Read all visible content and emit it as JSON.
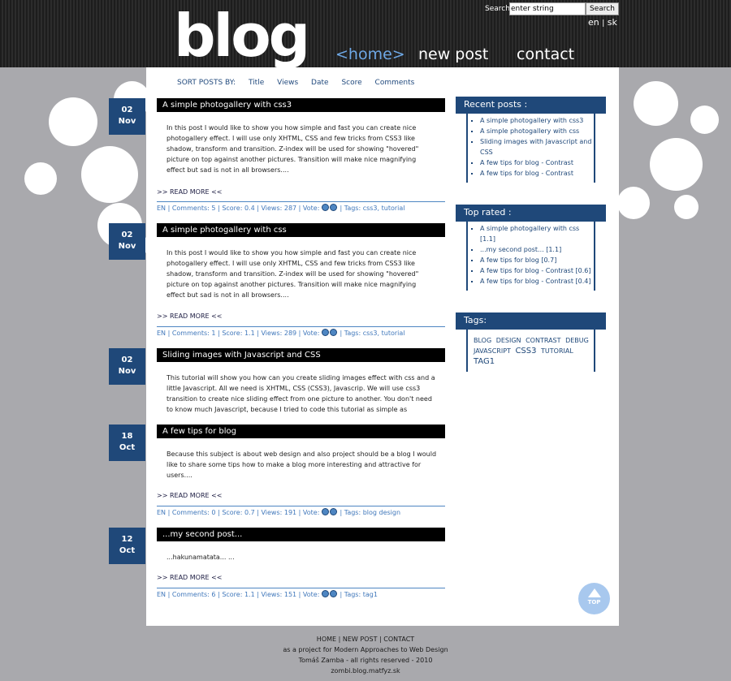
{
  "header": {
    "logo": "blog",
    "nav": [
      {
        "label": "<home>",
        "active": true
      },
      {
        "label": "new post",
        "active": false
      },
      {
        "label": "contact",
        "active": false
      }
    ],
    "search_label": "Search",
    "search_value": "enter string",
    "search_button": "Search",
    "lang_en": "en",
    "lang_sep": "|",
    "lang_sk": "sk"
  },
  "sort": {
    "label": "SORT POSTS BY:",
    "options": [
      "Title",
      "Views",
      "Date",
      "Score",
      "Comments"
    ]
  },
  "posts": [
    {
      "day": "02",
      "month": "Nov",
      "title": "A simple photogallery with css3",
      "body": "In this post I would like to show you how simple and fast you can create nice photogallery effect. I will use only XHTML, CSS and few tricks from CSS3 like shadow, transform and transition. Z-index will be used for showing \"hovered\" picture on top against another pictures. Transition will make nice magnifying effect but sad is not in all browsers....",
      "readmore": ">> READ MORE <<",
      "lang": "EN",
      "comments": "Comments: 5",
      "score": "Score: 0.4",
      "views": "Views: 287",
      "vote": "Vote:",
      "tags": "Tags: css3, tutorial"
    },
    {
      "day": "02",
      "month": "Nov",
      "title": "A simple photogallery with css",
      "body": "In this post I would like to show you how simple and fast you can create nice photogallery effect. I will use only XHTML, CSS and few tricks from CSS3 like shadow, transform and transition. Z-index will be used for showing \"hovered\" picture on top against another pictures. Transition will make nice magnifying effect but sad is not in all browsers....",
      "readmore": ">> READ MORE <<",
      "lang": "EN",
      "comments": "Comments: 1",
      "score": "Score: 1.1",
      "views": "Views: 289",
      "vote": "Vote:",
      "tags": "Tags: css3, tutorial"
    },
    {
      "day": "02",
      "month": "Nov",
      "title": "Sliding images with Javascript and CSS",
      "body": "This tutorial will show you how can you create sliding images effect with css and a little Javascript. All we need is XHTML, CSS (CSS3), Javascrip. We will use css3 transition to create nice sliding effect from one picture to another. You don't need to know much Javascript, because I tried to code this tutorial as simple as"
    },
    {
      "day": "18",
      "month": "Oct",
      "title": "A few tips for blog",
      "body": "Because this subject is about web design and also project should be a blog I would like to share some tips how to make a blog more interesting and attractive for users....",
      "readmore": ">> READ MORE <<",
      "lang": "EN",
      "comments": "Comments: 0",
      "score": "Score: 0.7",
      "views": "Views: 191",
      "vote": "Vote:",
      "tags": "Tags: blog design"
    },
    {
      "day": "12",
      "month": "Oct",
      "title": "...my second post...",
      "body": "...hakunamatata... ...",
      "readmore": ">> READ MORE <<",
      "lang": "EN",
      "comments": "Comments: 6",
      "score": "Score: 1.1",
      "views": "Views: 151",
      "vote": "Vote:",
      "tags": "Tags: tag1"
    }
  ],
  "sidebar": {
    "recent_title": "Recent posts :",
    "recent": [
      "A simple photogallery with css3",
      "A simple photogallery with css",
      "Sliding images with Javascript and CSS",
      "A few tips for blog - Contrast",
      "A few tips for blog - Contrast"
    ],
    "top_title": "Top rated :",
    "top": [
      "A simple photogallery with css [1.1]",
      "...my second post... [1.1]",
      "A few tips for blog [0.7]",
      "A few tips for blog - Contrast [0.6]",
      "A few tips for blog - Contrast [0.4]"
    ],
    "tags_title": "Tags:",
    "tags": [
      "BLOG",
      "DESIGN",
      "CONTRAST",
      "DEBUG",
      "JAVASCRIPT",
      "CSS3",
      "TUTORIAL",
      "TAG1"
    ]
  },
  "top_button": "TOP",
  "footer": {
    "links": [
      "HOME",
      "NEW POST",
      "CONTACT"
    ],
    "sep": "|",
    "line1": "as a project for Modern Approaches to Web Design",
    "line2": "Tomáš Zamba - all rights reserved - 2010",
    "line3": "zombi.blog.matfyz.sk"
  },
  "colors": {
    "accent": "#1f4879",
    "link": "#4178bb",
    "background": "#a9a9ad"
  }
}
